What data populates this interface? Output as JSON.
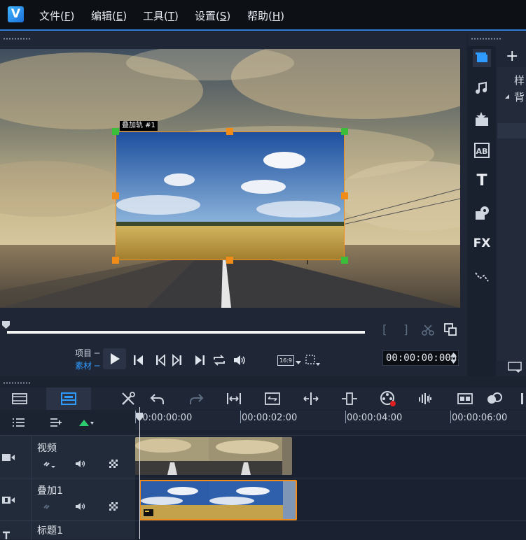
{
  "menu": [
    "文件(F)",
    "编辑(E)",
    "工具(T)",
    "设置(S)",
    "帮助(H)"
  ],
  "menu_keys": [
    "F",
    "E",
    "T",
    "S",
    "H"
  ],
  "menu_labels": [
    "文件",
    "编辑",
    "工具",
    "设置",
    "帮助"
  ],
  "preview": {
    "overlay_tag": "叠加轨 #1",
    "mark_in": "[",
    "mark_out": "]",
    "mode_project": "项目",
    "mode_clip": "素材",
    "aspect": "16:9",
    "timecode": "00:00:00:000"
  },
  "library": {
    "items": [
      "样",
      "背"
    ],
    "tool_icons": [
      "media-icon",
      "music-icon",
      "instant-project-icon",
      "transition-icon",
      "title-icon",
      "graphics-icon",
      "filter-icon",
      "path-icon"
    ],
    "fx_label": "FX",
    "ab_label": "AB",
    "title_label": "T",
    "add_label": "+"
  },
  "timeline": {
    "ruler": [
      "00:00:00:00",
      "00:00:02:00",
      "00:00:04:00",
      "00:00:06:00"
    ],
    "tracks": [
      {
        "name": "视频"
      },
      {
        "name": "叠加1"
      },
      {
        "name": "标题1"
      }
    ]
  },
  "colors": {
    "accent": "#2f7fd6",
    "selection": "#f28c18",
    "active_mode": "#2f9bff"
  }
}
